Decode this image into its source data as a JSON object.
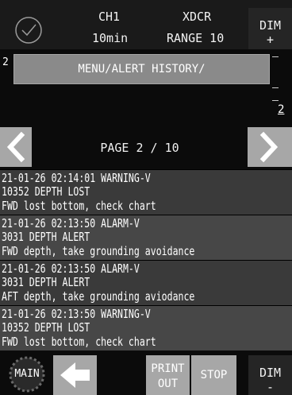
{
  "header": {
    "channel": "CH1",
    "interval": "10min",
    "mode": "XDCR",
    "range": "RANGE 10",
    "dim_up_label": "DIM",
    "dim_up_symbol": "+"
  },
  "status": {
    "icon": "checkmark-circle-icon"
  },
  "side": {
    "left_number": "2",
    "scale_bottom_label": "2"
  },
  "menu": {
    "title": "MENU/ALERT HISTORY/"
  },
  "pagination": {
    "indicator": "PAGE 2 / 10",
    "current_page": 2,
    "total_pages": 10
  },
  "alerts": [
    {
      "line1": "21-01-26 02:14:01 WARNING-V",
      "line2": "10352 DEPTH LOST",
      "line3": "FWD lost bottom, check chart"
    },
    {
      "line1": "21-01-26 02:13:50 ALARM-V",
      "line2": "3031 DEPTH ALERT",
      "line3": "FWD depth, take grounding avoidance"
    },
    {
      "line1": "21-01-26 02:13:50 ALARM-V",
      "line2": "3031 DEPTH ALERT",
      "line3": "AFT depth, take grounding aviodance"
    },
    {
      "line1": "21-01-26 02:13:50 WARNING-V",
      "line2": "10352 DEPTH LOST",
      "line3": "FWD lost bottom, check chart"
    }
  ],
  "footer": {
    "main_label": "MAIN",
    "print_line1": "PRINT",
    "print_line2": "OUT",
    "stop_label": "STOP",
    "dim_down_label": "DIM",
    "dim_down_symbol": "-"
  },
  "colors": {
    "background": "#0b0b0b",
    "button_gray": "#a7a7a7",
    "banner_gray": "#8a8a8a",
    "row_dark": "#3a3a3a",
    "row_light": "#474747"
  }
}
